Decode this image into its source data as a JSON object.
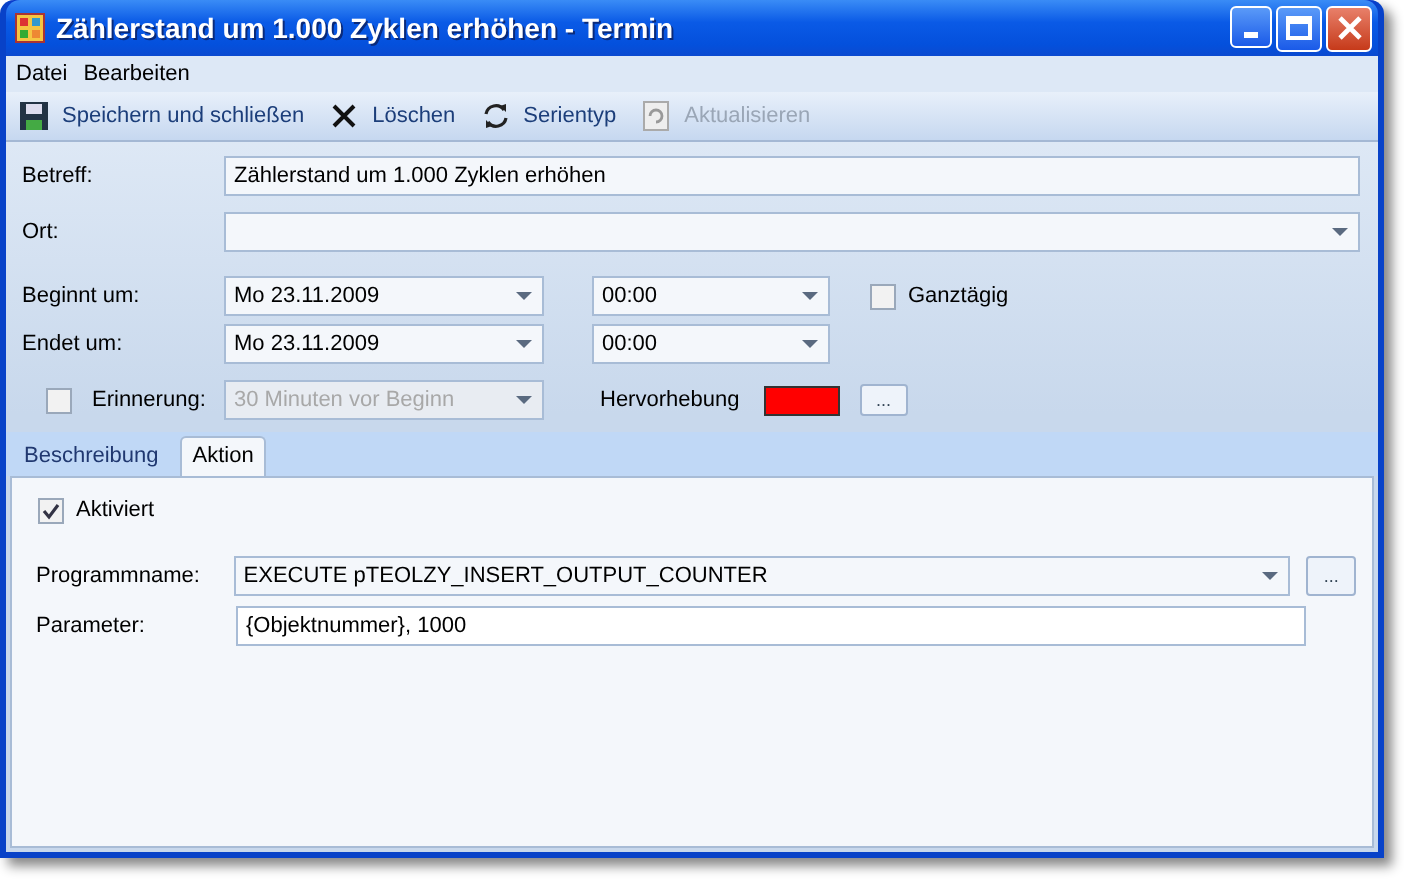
{
  "window": {
    "title": "Zählerstand um 1.000 Zyklen erhöhen - Termin"
  },
  "menu": [
    "Datei",
    "Bearbeiten"
  ],
  "toolbar": [
    {
      "kind": "save",
      "label": "Speichern und schließen",
      "disabled": false
    },
    {
      "kind": "delete",
      "label": "Löschen",
      "disabled": false
    },
    {
      "kind": "recur",
      "label": "Serientyp",
      "disabled": false
    },
    {
      "kind": "refresh",
      "label": "Aktualisieren",
      "disabled": true
    }
  ],
  "subject": {
    "label": "Betreff:",
    "value": "Zählerstand um 1.000 Zyklen erhöhen"
  },
  "location": {
    "label": "Ort:"
  },
  "start": {
    "label": "Beginnt um:",
    "date": "Mo 23.11.2009",
    "time": "00:00"
  },
  "end": {
    "label": "Endet um:",
    "date": "Mo 23.11.2009",
    "time": "00:00"
  },
  "all_day": {
    "label": "Ganztägig",
    "checked": false
  },
  "reminder": {
    "label": "Erinnerung:",
    "checked": false,
    "value": "30 Minuten vor Beginn",
    "disabled": true
  },
  "highlight": {
    "label": "Hervorhebung",
    "color": "#ff0000",
    "button": "..."
  },
  "tabs": [
    {
      "label": "Beschreibung",
      "selected": false
    },
    {
      "label": "Aktion",
      "selected": true
    }
  ],
  "action": {
    "enabled": {
      "label": "Aktiviert",
      "checked": true
    },
    "program": {
      "label": "Programmname:",
      "value": "EXECUTE  pTEOLZY_INSERT_OUTPUT_COUNTER",
      "button": "..."
    },
    "parameter": {
      "label": "Parameter:",
      "value": "{Objektnummer}, 1000"
    }
  }
}
